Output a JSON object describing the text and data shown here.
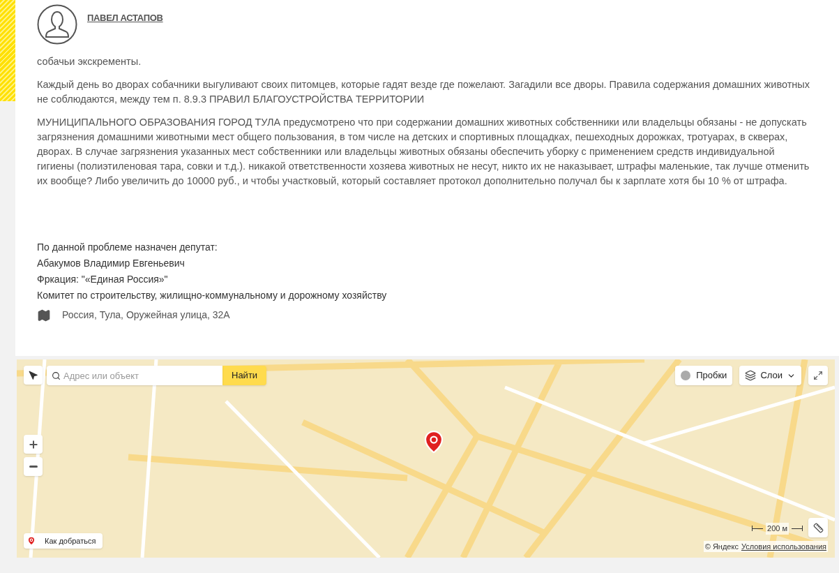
{
  "author": {
    "name": "ПАВЕЛ АСТАПОВ"
  },
  "paragraphs": [
    "собачьи экскременты.",
    "Каждый день во дворах собачники выгуливают своих питомцев, которые гадят везде где пожелают. Загадили все дворы. Правила содержания домашних животных не соблюдаются, между тем п. 8.9.3 ПРАВИЛ БЛАГОУСТРОЙСТВА ТЕРРИТОРИИ",
    "МУНИЦИПАЛЬНОГО ОБРАЗОВАНИЯ ГОРОД ТУЛА предусмотрено что при содержании домашних животных собственники или владельцы обязаны - не допускать загрязнения домашними животными мест общего пользования, в том числе на детских и спортивных площадках, пешеходных дорожках, тротуарах, в скверах, дворах. В случае загрязнения указанных мест собственники или владельцы животных обязаны обеспечить уборку с применением средств индивидуальной гигиены (полиэтиленовая тара, совки и т.д.). никакой ответственности хозяева животных не несут, никто их не наказывает, штрафы маленькие, так лучше отменить их вообще? Либо увеличить до 10000 руб., и чтобы участковый, который составляет протокол дополнительно получал бы к зарплате хотя бы 10 % от штрафа."
  ],
  "deputy": [
    "По данной проблеме назначен депутат:",
    "Абакумов Владимир Евгеньевич",
    "Фркация: \"«Единая Россия»\"",
    "Комитет по строительству, жилищно-коммунальному и дорожному хозяйству"
  ],
  "address": "Россия, Тула, Оружейная улица, 32А",
  "map": {
    "search": {
      "placeholder": "Адрес или объект",
      "button": "Найти"
    },
    "traffic_button": "Пробки",
    "layers_button": "Слои",
    "route_button": "Как добраться",
    "scale": "200 м",
    "copyright": "© Яндекс",
    "terms_link": "Условия использования"
  }
}
